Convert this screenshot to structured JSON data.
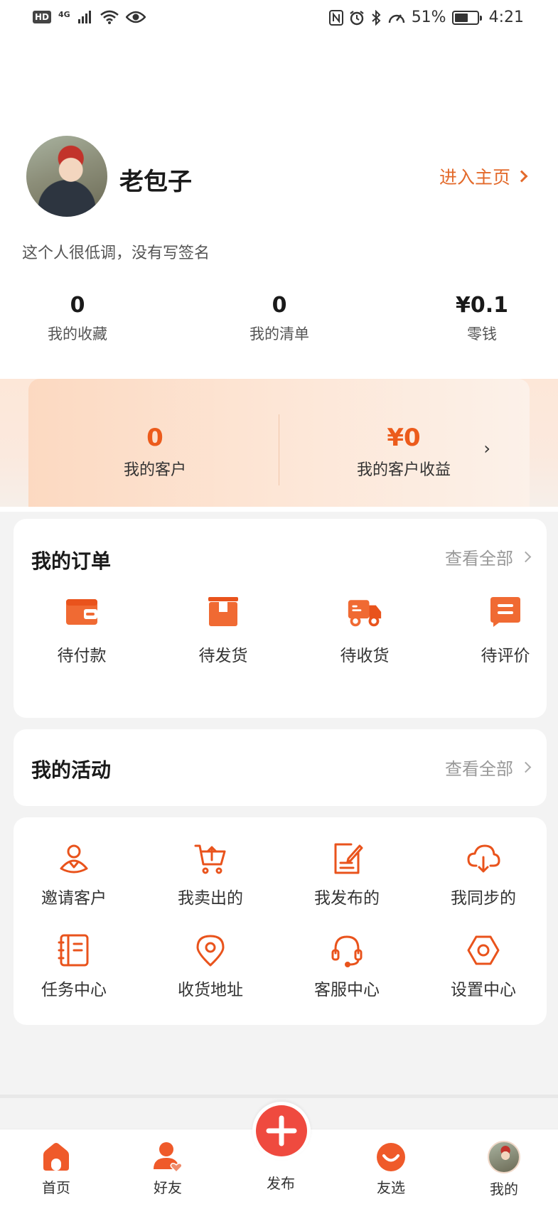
{
  "status_bar": {
    "network": "4G",
    "hd": "HD",
    "battery": "51%",
    "battery_level": 0.51,
    "time": "4:21"
  },
  "profile": {
    "name": "老包子",
    "home_link": "进入主页",
    "signature": "这个人很低调，没有写签名"
  },
  "stats": [
    {
      "value": "0",
      "label": "我的收藏"
    },
    {
      "value": "0",
      "label": "我的清单"
    },
    {
      "value": "¥0.1",
      "label": "零钱"
    }
  ],
  "customers": {
    "count": "0",
    "count_label": "我的客户",
    "earnings": "¥0",
    "earnings_label": "我的客户收益"
  },
  "orders": {
    "title": "我的订单",
    "view_all": "查看全部",
    "items": [
      {
        "label": "待付款",
        "icon": "wallet-icon"
      },
      {
        "label": "待发货",
        "icon": "box-icon"
      },
      {
        "label": "待收货",
        "icon": "truck-icon"
      },
      {
        "label": "待评价",
        "icon": "comment-icon"
      }
    ]
  },
  "activities": {
    "title": "我的活动",
    "view_all": "查看全部"
  },
  "services": {
    "items": [
      {
        "label": "邀请客户",
        "icon": "invite-user-icon"
      },
      {
        "label": "我卖出的",
        "icon": "cart-upload-icon"
      },
      {
        "label": "我发布的",
        "icon": "edit-document-icon"
      },
      {
        "label": "我同步的",
        "icon": "cloud-sync-icon"
      },
      {
        "label": "任务中心",
        "icon": "notebook-icon"
      },
      {
        "label": "收货地址",
        "icon": "location-pin-icon"
      },
      {
        "label": "客服中心",
        "icon": "headset-icon"
      },
      {
        "label": "设置中心",
        "icon": "settings-hexagon-icon"
      }
    ]
  },
  "bottom_nav": [
    {
      "label": "首页",
      "icon": "home-icon"
    },
    {
      "label": "好友",
      "icon": "friends-icon"
    },
    {
      "label": "发布",
      "icon": "plus-icon"
    },
    {
      "label": "友选",
      "icon": "smile-icon"
    },
    {
      "label": "我的",
      "icon": "avatar"
    }
  ],
  "colors": {
    "accent": "#ec5b1b",
    "link": "#e36a2b",
    "publish": "#ef4a3f"
  }
}
